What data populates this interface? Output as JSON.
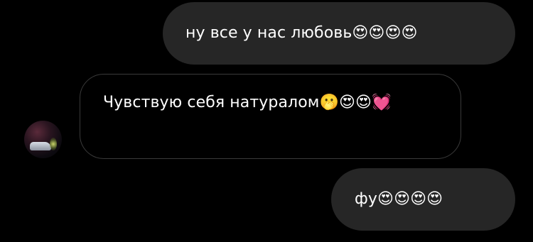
{
  "messages": [
    {
      "direction": "outgoing",
      "text": "ну все у нас любовь😍😍😍😍"
    },
    {
      "direction": "incoming",
      "text": "Чувствую себя натуралом🫢😍😍💓",
      "sender_avatar": "avatar"
    },
    {
      "direction": "outgoing",
      "text": "фу😍😍😍😍"
    }
  ],
  "colors": {
    "background": "#000000",
    "outgoing_bubble": "#262626",
    "incoming_border": "#3a3a3a",
    "text": "#ffffff"
  }
}
